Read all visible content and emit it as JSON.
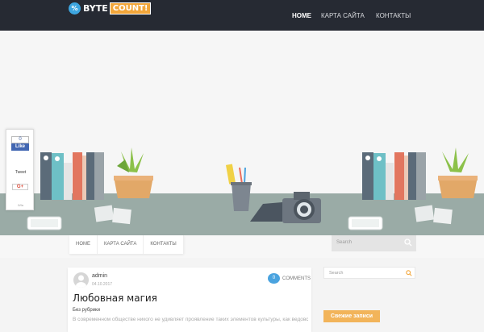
{
  "header": {
    "logo_mark": "%",
    "logo_word1": "BYTE",
    "logo_word2": "COUNT!",
    "nav": [
      {
        "label": "HOME",
        "active": true
      },
      {
        "label": "КАРТА САЙТА",
        "active": false
      },
      {
        "label": "КОНТАКТЫ",
        "active": false
      }
    ]
  },
  "social": {
    "fb_count": "0",
    "fb_like": "Like",
    "tweet": "Tweet",
    "gplus": "G+",
    "gplus_count": "0/fa"
  },
  "subnav": {
    "items": [
      "HOME",
      "КАРТА САЙТА",
      "КОНТАКТЫ"
    ],
    "search_placeholder": "Search"
  },
  "post": {
    "author": "admin",
    "date": "04.10.2017",
    "comments_count": "0",
    "comments_label": "COMMENTS",
    "title": "Любовная магия",
    "category": "Без рубрики",
    "excerpt": "В современном обществе никого не удивляет проявление таких элементов культуры, как ведовство"
  },
  "sidebar": {
    "search_placeholder": "Search",
    "widget_title": "Свежие записи"
  },
  "colors": {
    "topbar": "#262a33",
    "accent_blue": "#4aa3df",
    "accent_orange": "#f2b45a",
    "desk": "#9aaba6"
  },
  "icons": [
    "logo-icon",
    "search-icon",
    "avatar-icon"
  ]
}
